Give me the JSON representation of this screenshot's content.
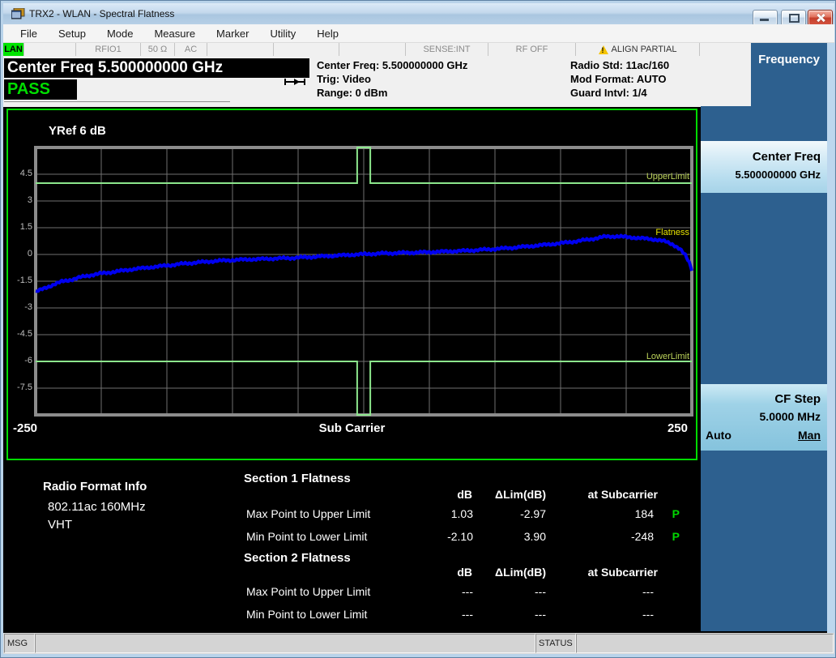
{
  "window": {
    "title": "TRX2 - WLAN - Spectral Flatness"
  },
  "menu": {
    "items": [
      "File",
      "Setup",
      "Mode",
      "Measure",
      "Marker",
      "Utility",
      "Help"
    ]
  },
  "status_strip": {
    "cells": [
      "LAN",
      "",
      "RFIO1",
      "50 Ω",
      "AC",
      "",
      "",
      "",
      "SENSE:INT",
      "RF OFF",
      "ALIGN PARTIAL",
      ""
    ]
  },
  "header": {
    "annunciator": "Center Freq 5.500000000 GHz",
    "verdict": "PASS",
    "mid_col": [
      "Center Freq: 5.500000000 GHz",
      "Trig: Video",
      "Range: 0 dBm"
    ],
    "right_col": [
      "Radio Std: 11ac/160",
      "Mod Format: AUTO",
      "Guard Intvl: 1/4"
    ]
  },
  "graph": {
    "yref_label": "YRef  6 dB",
    "y_ticks": [
      "4.5",
      "3",
      "1.5",
      "0",
      "-1.5",
      "-3",
      "-4.5",
      "-6",
      "-7.5"
    ],
    "x_left": "-250",
    "x_title": "Sub Carrier",
    "x_right": "250",
    "trace_labels": {
      "upper": "UpperLimit",
      "flatness": "Flatness",
      "lower": "LowerLimit"
    },
    "axis": {
      "xmin": -250,
      "xmax": 250,
      "ymax": 6,
      "ymin": -9
    },
    "limits": {
      "upper_db": 4,
      "lower_db": -6,
      "notch_half_width": 5
    },
    "trace_color": "#0000f0",
    "limit_color": "#8ce68c",
    "trace_points": [
      [
        -250,
        -2.1
      ],
      [
        -245,
        -1.95
      ],
      [
        -240,
        -1.8
      ],
      [
        -235,
        -1.65
      ],
      [
        -230,
        -1.52
      ],
      [
        -225,
        -1.45
      ],
      [
        -220,
        -1.36
      ],
      [
        -213,
        -1.23
      ],
      [
        -205,
        -1.12
      ],
      [
        -195,
        -1.02
      ],
      [
        -185,
        -0.92
      ],
      [
        -175,
        -0.82
      ],
      [
        -165,
        -0.74
      ],
      [
        -155,
        -0.66
      ],
      [
        -145,
        -0.58
      ],
      [
        -135,
        -0.5
      ],
      [
        -125,
        -0.44
      ],
      [
        -115,
        -0.38
      ],
      [
        -105,
        -0.33
      ],
      [
        -95,
        -0.3
      ],
      [
        -85,
        -0.27
      ],
      [
        -75,
        -0.25
      ],
      [
        -65,
        -0.22
      ],
      [
        -55,
        -0.2
      ],
      [
        -45,
        -0.16
      ],
      [
        -35,
        -0.12
      ],
      [
        -25,
        -0.08
      ],
      [
        -15,
        -0.04
      ],
      [
        -5,
        0.0
      ],
      [
        5,
        0.03
      ],
      [
        15,
        0.06
      ],
      [
        25,
        0.08
      ],
      [
        35,
        0.1
      ],
      [
        45,
        0.12
      ],
      [
        60,
        0.16
      ],
      [
        75,
        0.2
      ],
      [
        90,
        0.26
      ],
      [
        105,
        0.33
      ],
      [
        120,
        0.42
      ],
      [
        135,
        0.52
      ],
      [
        150,
        0.63
      ],
      [
        160,
        0.72
      ],
      [
        170,
        0.82
      ],
      [
        178,
        0.92
      ],
      [
        184,
        1.0
      ],
      [
        192,
        1.02
      ],
      [
        200,
        0.98
      ],
      [
        208,
        0.93
      ],
      [
        216,
        0.88
      ],
      [
        224,
        0.82
      ],
      [
        230,
        0.72
      ],
      [
        236,
        0.55
      ],
      [
        241,
        0.3
      ],
      [
        245,
        -0.05
      ],
      [
        248,
        -0.45
      ],
      [
        250,
        -0.85
      ]
    ]
  },
  "results": {
    "radio_info": {
      "title": "Radio Format Info",
      "lines": [
        "802.11ac 160MHz",
        "VHT"
      ]
    },
    "sections": [
      {
        "title": "Section 1 Flatness",
        "col_headers": [
          "dB",
          "ΔLim(dB)",
          "at Subcarrier"
        ],
        "rows": [
          {
            "label": "Max Point to Upper Limit",
            "db": "1.03",
            "dlim": "-2.97",
            "sc": "184",
            "pf": "P"
          },
          {
            "label": "Min Point to Lower Limit",
            "db": "-2.10",
            "dlim": "3.90",
            "sc": "-248",
            "pf": "P"
          }
        ]
      },
      {
        "title": "Section 2 Flatness",
        "col_headers": [
          "dB",
          "ΔLim(dB)",
          "at Subcarrier"
        ],
        "rows": [
          {
            "label": "Max Point to Upper Limit",
            "db": "---",
            "dlim": "---",
            "sc": "---",
            "pf": ""
          },
          {
            "label": "Min Point to Lower Limit",
            "db": "---",
            "dlim": "---",
            "sc": "---",
            "pf": ""
          }
        ]
      }
    ]
  },
  "softkeys": {
    "menu_title": "Frequency",
    "center_freq": {
      "title": "Center Freq",
      "value": "5.500000000 GHz"
    },
    "cf_step": {
      "title": "CF Step",
      "value": "5.0000 MHz",
      "auto_label": "Auto",
      "man_label": "Man"
    }
  },
  "statusbar": {
    "msg": "MSG",
    "status": "STATUS"
  }
}
